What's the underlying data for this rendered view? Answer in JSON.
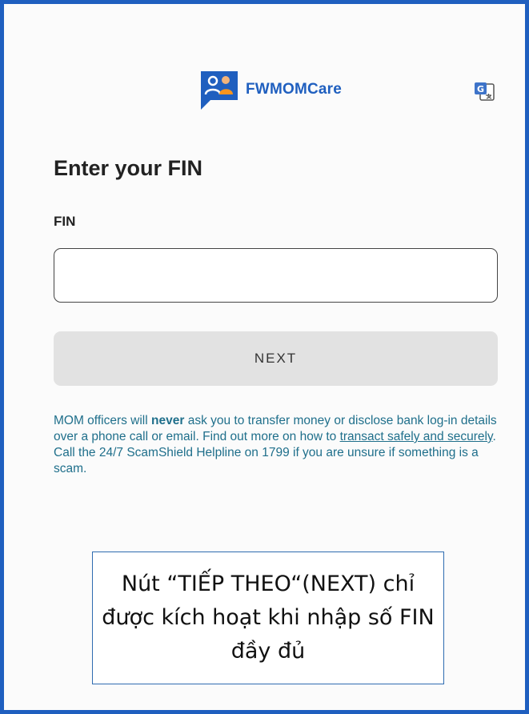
{
  "app": {
    "brand_name": "FWMOMCare"
  },
  "page": {
    "title": "Enter your FIN"
  },
  "form": {
    "fin_label": "FIN",
    "fin_value": "",
    "next_label": "NEXT"
  },
  "notice": {
    "part1": "MOM officers will ",
    "emphasis": "never",
    "part2": " ask you to transfer money or disclose bank log-in details over a phone call or email. Find out more on how to ",
    "link_text": "transact safely and securely",
    "part3": ". Call the 24/7 ScamShield Helpline on 1799 if you are unsure if something is a scam."
  },
  "annotation": {
    "text": "Nút “TIẾP THEO“(NEXT) chỉ được kích hoạt khi nhập số FIN đầy đủ"
  },
  "icons": {
    "brand_logo": "fwmomcare-logo-icon",
    "translate": "translate-icon"
  },
  "colors": {
    "brand": "#1f5fbf",
    "notice_text": "#1f6f8b",
    "button_disabled": "#e2e2e2"
  }
}
